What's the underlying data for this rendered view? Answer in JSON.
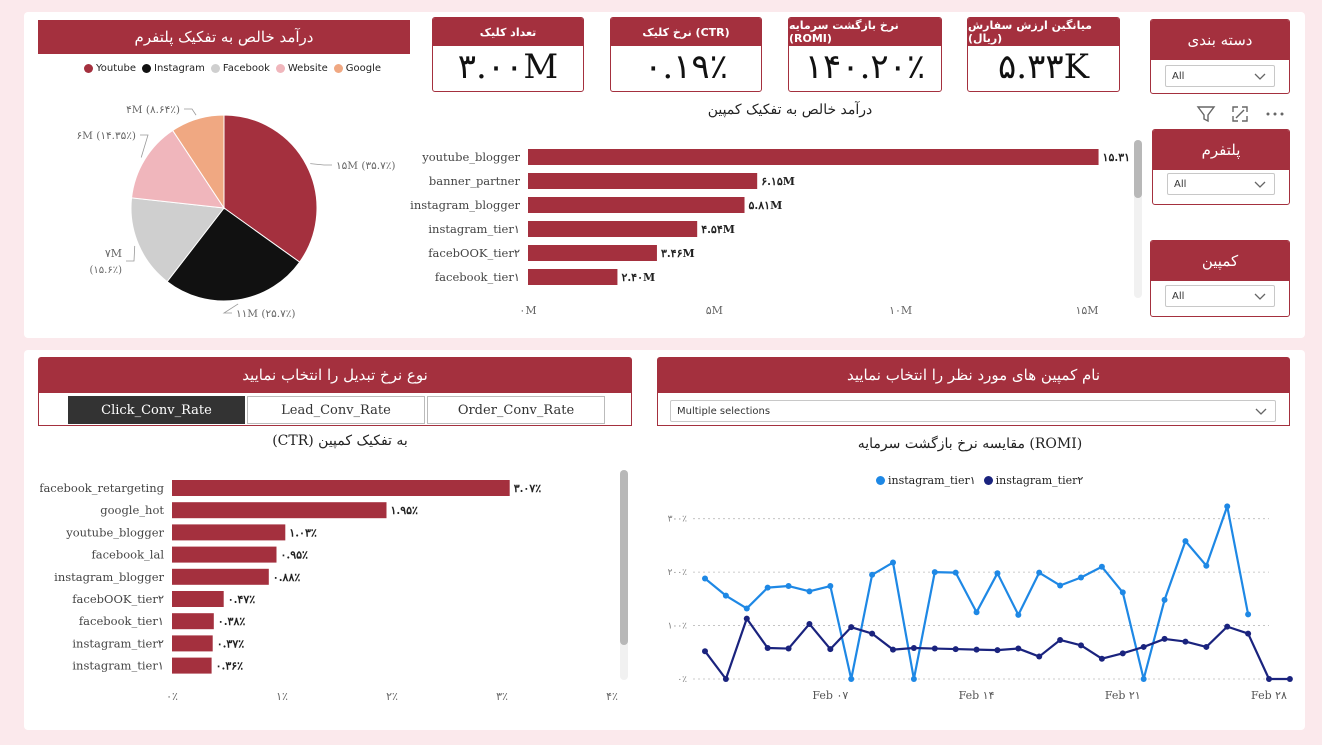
{
  "top_left": {
    "title": "درآمد خالص به تفکیک پلتفرم",
    "legend": [
      {
        "name": "Youtube",
        "color": "#a4303e"
      },
      {
        "name": "Instagram",
        "color": "#111111"
      },
      {
        "name": "Facebook",
        "color": "#cfcfcf"
      },
      {
        "name": "Website",
        "color": "#f0b6bc"
      },
      {
        "name": "Google",
        "color": "#f0a882"
      }
    ]
  },
  "kpis": [
    {
      "title": "تعداد کلیک",
      "value": "۳.۰۰M"
    },
    {
      "title": "نرخ کلیک (CTR)",
      "value": "۰.۱۹٪"
    },
    {
      "title": "نرخ بازگشت سرمایه (ROMI)",
      "value": "۱۴۰.۲۰٪"
    },
    {
      "title": "میانگین ارزش سفارش (ریال)",
      "value": "۵.۳۳K"
    }
  ],
  "slicers": [
    {
      "title": "دسته بندی",
      "value": "All"
    },
    {
      "title": "پلتفرم",
      "value": "All"
    },
    {
      "title": "کمپین",
      "value": "All"
    }
  ],
  "bottom_left": {
    "header": "نوع نرخ تبدیل را انتخاب نمایید",
    "buttons": [
      "Click_Conv_Rate",
      "Lead_Conv_Rate",
      "Order_Conv_Rate"
    ]
  },
  "bottom_right": {
    "header": "نام کمپین های مورد نظر را انتخاب نمایید",
    "select_value": "Multiple selections"
  },
  "chart_data": [
    {
      "type": "pie",
      "title": "درآمد خالص به تفکیک پلتفرم",
      "slices": [
        {
          "name": "Youtube",
          "value": 15,
          "label": "۱۵M (۳۵.۷٪)",
          "color": "#a4303e"
        },
        {
          "name": "Instagram",
          "value": 11,
          "label": "۱۱M (۲۵.۷٪)",
          "color": "#111111"
        },
        {
          "name": "Facebook",
          "value": 7,
          "label": "۷M (۱۵.۶٪)",
          "color": "#cfcfcf"
        },
        {
          "name": "Website",
          "value": 6,
          "label": "۶M (۱۴.۳۵٪)",
          "color": "#f0b6bc"
        },
        {
          "name": "Google",
          "value": 4,
          "label": "۴M (۸.۶۴٪)",
          "color": "#f0a882"
        }
      ]
    },
    {
      "type": "bar",
      "title": "درآمد خالص به تفکیک کمپین",
      "categories": [
        "youtube_blogger",
        "banner_partner",
        "instagram_blogger",
        "instagram_tier۱",
        "facebOOK_tier۲",
        "facebook_tier۱"
      ],
      "values": [
        15.31,
        6.15,
        5.81,
        4.54,
        3.46,
        2.4
      ],
      "data_labels": [
        "۱۵.۳۱M",
        "۶.۱۵M",
        "۵.۸۱M",
        "۴.۵۴M",
        "۳.۴۶M",
        "۲.۴۰M"
      ],
      "xlim": [
        0,
        15
      ],
      "x_ticks": [
        0,
        5,
        10,
        15
      ],
      "x_tick_labels": [
        "۰M",
        "۵M",
        "۱۰M",
        "۱۵M"
      ]
    },
    {
      "type": "bar",
      "title": "(CTR) به تفکیک کمپین",
      "categories": [
        "facebook_retargeting",
        "google_hot",
        "youtube_blogger",
        "facebook_lal",
        "instagram_blogger",
        "facebOOK_tier۲",
        "facebook_tier۱",
        "instagram_tier۲",
        "instagram_tier۱"
      ],
      "values": [
        3.07,
        1.95,
        1.03,
        0.95,
        0.88,
        0.47,
        0.38,
        0.37,
        0.36
      ],
      "data_labels": [
        "۳.۰۷٪",
        "۱.۹۵٪",
        "۱.۰۳٪",
        "۰.۹۵٪",
        "۰.۸۸٪",
        "۰.۴۷٪",
        "۰.۳۸٪",
        "۰.۳۷٪",
        "۰.۳۶٪"
      ],
      "xlim": [
        0,
        4
      ],
      "x_ticks": [
        0,
        1,
        2,
        3,
        4
      ],
      "x_tick_labels": [
        "۰٪",
        "۱٪",
        "۲٪",
        "۳٪",
        "۴٪"
      ]
    },
    {
      "type": "line",
      "title": "مقایسه نرخ بازگشت سرمایه (ROMI)",
      "x": [
        "۲۰۲۳-۰۲-۰۱",
        "۲۰۲۳-۰۲-۰۲",
        "۲۰۲۳-۰۲-۰۳",
        "۲۰۲۳-۰۲-۰۴",
        "۲۰۲۳-۰۲-۰۵",
        "۲۰۲۳-۰۲-۰۶",
        "۲۰۲۳-۰۲-۰۷",
        "۲۰۲۳-۰۲-۰۸",
        "۲۰۲۳-۰۲-۰۹",
        "۲۰۲۳-۰۲-۱۰",
        "۲۰۲۳-۰۲-۱۱",
        "۲۰۲۳-۰۲-۱۲",
        "۲۰۲۳-۰۲-۱۳",
        "۲۰۲۳-۰۲-۱۴",
        "۲۰۲۳-۰۲-۱۵",
        "۲۰۲۳-۰۲-۱۶",
        "۲۰۲۳-۰۲-۱۷",
        "۲۰۲۳-۰۲-۱۸",
        "۲۰۲۳-۰۲-۱۹",
        "۲۰۲۳-۰۲-۲۰",
        "۲۰۲۳-۰۲-۲۱",
        "۲۰۲۳-۰۲-۲۲",
        "۲۰۲۳-۰۲-۲۳",
        "۲۰۲۳-۰۲-۲۴",
        "۲۰۲۳-۰۲-۲۵",
        "۲۰۲۳-۰۲-۲۶",
        "۲۰۲۳-۰۲-۲۷",
        "۲۰۲۳-۰۲-۲۸"
      ],
      "x_ticks": [
        "Feb ۰۷",
        "Feb ۱۴",
        "Feb ۲۱",
        "Feb ۲۸"
      ],
      "y_ticks": [
        0,
        100,
        200,
        300
      ],
      "y_tick_labels": [
        "۰٪",
        "۱۰۰٪",
        "۲۰۰٪",
        "۳۰۰٪"
      ],
      "ylim": [
        0,
        320
      ],
      "series": [
        {
          "name": "instagram_tier۱",
          "color": "#1e88e5",
          "values": [
            188,
            156,
            132,
            171,
            174,
            164,
            174,
            0,
            195,
            218,
            0,
            200,
            199,
            125,
            198,
            120,
            199,
            175,
            190,
            210,
            162,
            0,
            148,
            258,
            212,
            323,
            121
          ]
        },
        {
          "name": "instagram_tier۲",
          "color": "#1a237e",
          "values": [
            52,
            0,
            113,
            58,
            57,
            103,
            56,
            97,
            85,
            55,
            58,
            57,
            56,
            55,
            54,
            57,
            42,
            73,
            63,
            38,
            48,
            60,
            75,
            70,
            60,
            98,
            85,
            0,
            0
          ]
        }
      ]
    }
  ]
}
